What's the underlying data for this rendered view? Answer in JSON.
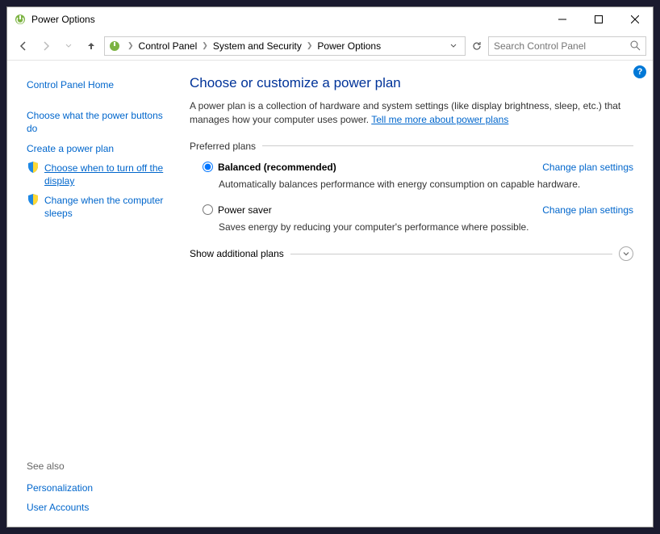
{
  "title": "Power Options",
  "breadcrumb": {
    "items": [
      "Control Panel",
      "System and Security",
      "Power Options"
    ]
  },
  "search": {
    "placeholder": "Search Control Panel"
  },
  "sidebar": {
    "home": "Control Panel Home",
    "links": [
      "Choose what the power buttons do",
      "Create a power plan",
      "Choose when to turn off the display",
      "Change when the computer sleeps"
    ],
    "seeAlso": "See also",
    "related": [
      "Personalization",
      "User Accounts"
    ]
  },
  "main": {
    "heading": "Choose or customize a power plan",
    "description": "A power plan is a collection of hardware and system settings (like display brightness, sleep, etc.) that manages how your computer uses power. ",
    "moreLink": "Tell me more about power plans",
    "preferredLabel": "Preferred plans",
    "plans": [
      {
        "name": "Balanced (recommended)",
        "desc": "Automatically balances performance with energy consumption on capable hardware.",
        "change": "Change plan settings",
        "selected": true
      },
      {
        "name": "Power saver",
        "desc": "Saves energy by reducing your computer's performance where possible.",
        "change": "Change plan settings",
        "selected": false
      }
    ],
    "showAdditional": "Show additional plans"
  }
}
